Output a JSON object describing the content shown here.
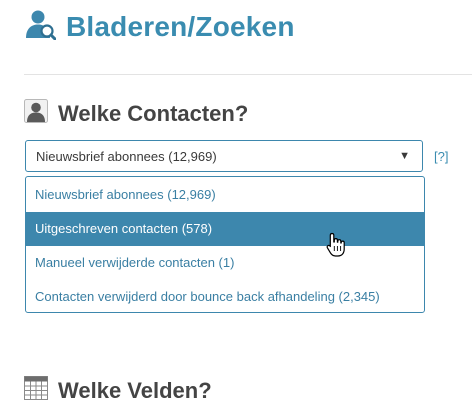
{
  "header": {
    "title": "Bladeren/Zoeken",
    "icon": "user-search-icon"
  },
  "contacts_section": {
    "title": "Welke Contacten?",
    "icon": "user-icon",
    "selected_value": "Nieuwsbrief abonnees (12,969)",
    "help": "[?]",
    "options": [
      {
        "label": "Nieuwsbrief abonnees (12,969)",
        "highlighted": false
      },
      {
        "label": "Uitgeschreven contacten (578)",
        "highlighted": true
      },
      {
        "label": "Manueel verwijderde contacten (1)",
        "highlighted": false
      },
      {
        "label": "Contacten verwijderd door bounce back afhandeling (2,345)",
        "highlighted": false
      }
    ]
  },
  "fields_section": {
    "title": "Welke Velden?",
    "icon": "table-icon"
  },
  "colors": {
    "accent": "#3a8cb0",
    "highlight": "#3d87ad",
    "heading": "#444444"
  }
}
